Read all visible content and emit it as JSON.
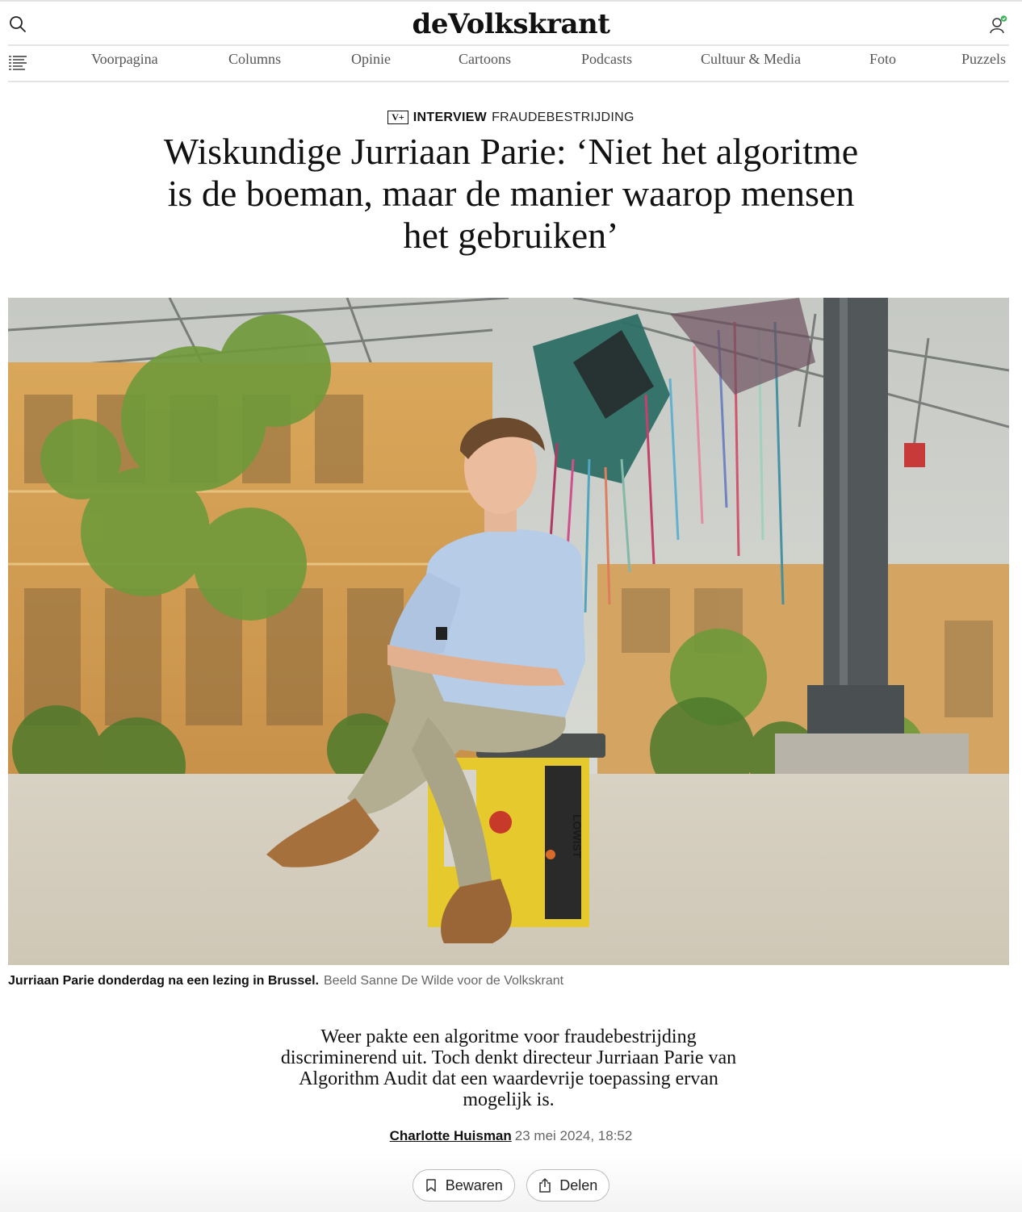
{
  "header": {
    "logo": "deVolkskrant"
  },
  "nav": {
    "items": [
      {
        "label": "Voorpagina"
      },
      {
        "label": "Columns"
      },
      {
        "label": "Opinie"
      },
      {
        "label": "Cartoons"
      },
      {
        "label": "Podcasts"
      },
      {
        "label": "Cultuur & Media"
      },
      {
        "label": "Foto"
      },
      {
        "label": "Puzzels"
      }
    ]
  },
  "article": {
    "badge": "V+",
    "type": "INTERVIEW",
    "topic": "FRAUDEBESTRIJDING",
    "headline": "Wiskundige Jurriaan Parie: ‘Niet het algoritme is de boeman, maar de manier waarop mensen het gebruiken’",
    "photo": {
      "caption": "Jurriaan Parie donderdag na een lezing in Brussel.",
      "credit": "Beeld Sanne De Wilde voor de Volkskrant",
      "box_label": "LOWIST"
    },
    "intro": "Weer pakte een algoritme voor fraudebestrijding discriminerend uit. Toch denkt directeur Jurriaan Parie van Algorithm Audit dat een waardevrije toepassing ervan mogelijk is.",
    "author": "Charlotte Huisman",
    "date": "23 mei 2024, 18:52"
  },
  "actions": {
    "save_label": "Bewaren",
    "share_label": "Delen"
  },
  "colors": {
    "text": "#111111",
    "muted": "#666666",
    "rule": "#e4e4e4",
    "status_dot": "#3cb35a"
  }
}
